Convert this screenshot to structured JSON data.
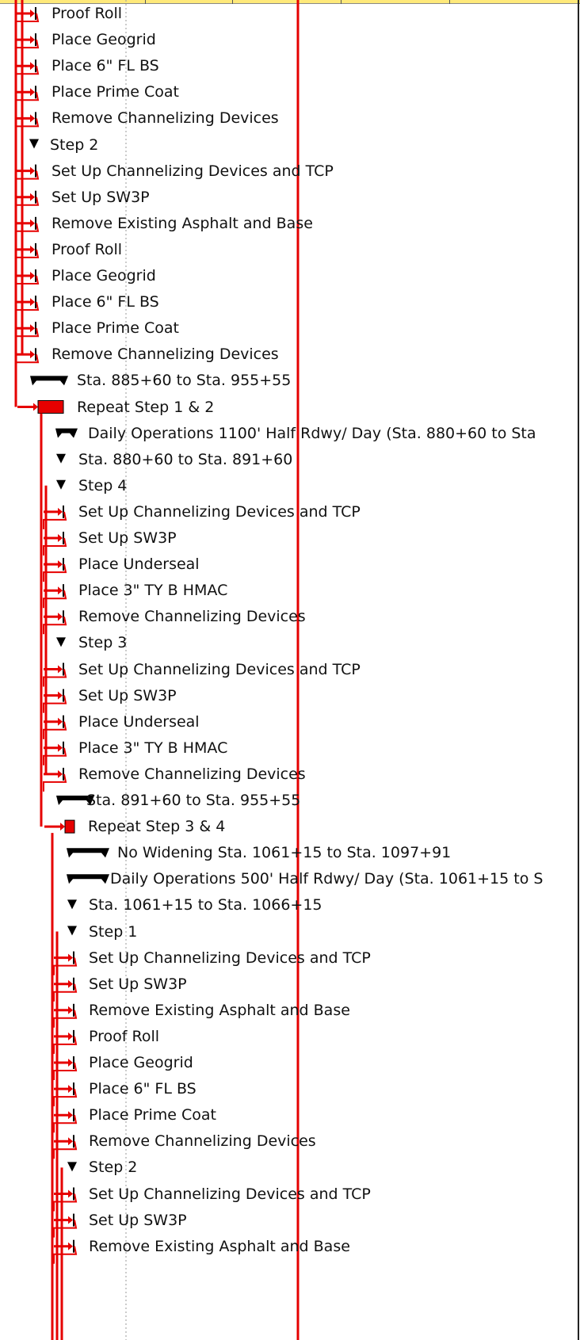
{
  "colors": {
    "link": "#e60000",
    "summary": "#000000",
    "task_bar": "#e60000",
    "grid_dotted": "#9a9a9a",
    "header_band": "#ffe97a"
  },
  "rows": [
    {
      "label": "Proof Roll",
      "kind": "task"
    },
    {
      "label": "Place Geogrid",
      "kind": "task"
    },
    {
      "label": "Place 6\" FL BS",
      "kind": "task"
    },
    {
      "label": "Place Prime Coat",
      "kind": "task"
    },
    {
      "label": "Remove Channelizing Devices",
      "kind": "task"
    },
    {
      "label": "Step 2",
      "kind": "group"
    },
    {
      "label": "Set Up Channelizing Devices and TCP",
      "kind": "task"
    },
    {
      "label": "Set Up SW3P",
      "kind": "task"
    },
    {
      "label": "Remove Existing Asphalt and Base",
      "kind": "task"
    },
    {
      "label": "Proof Roll",
      "kind": "task"
    },
    {
      "label": "Place Geogrid",
      "kind": "task"
    },
    {
      "label": "Place 6\" FL BS",
      "kind": "task"
    },
    {
      "label": "Place Prime Coat",
      "kind": "task"
    },
    {
      "label": "Remove Channelizing Devices",
      "kind": "task"
    },
    {
      "label": "Sta. 885+60 to Sta. 955+55",
      "kind": "summary"
    },
    {
      "label": "Repeat Step 1 & 2",
      "kind": "bar"
    },
    {
      "label": "Daily Operations 1100' Half Rdwy/ Day (Sta. 880+60 to Sta",
      "kind": "summary"
    },
    {
      "label": "Sta. 880+60 to Sta. 891+60",
      "kind": "group"
    },
    {
      "label": "Step 4",
      "kind": "group"
    },
    {
      "label": "Set Up Channelizing Devices and TCP",
      "kind": "task"
    },
    {
      "label": "Set Up SW3P",
      "kind": "task"
    },
    {
      "label": "Place Underseal",
      "kind": "task"
    },
    {
      "label": "Place 3\" TY B HMAC",
      "kind": "task"
    },
    {
      "label": "Remove Channelizing Devices",
      "kind": "task"
    },
    {
      "label": "Step 3",
      "kind": "group"
    },
    {
      "label": "Set Up Channelizing Devices and TCP",
      "kind": "task"
    },
    {
      "label": "Set Up SW3P",
      "kind": "task"
    },
    {
      "label": "Place Underseal",
      "kind": "task"
    },
    {
      "label": "Place 3\" TY B HMAC",
      "kind": "task"
    },
    {
      "label": "Remove Channelizing Devices",
      "kind": "task"
    },
    {
      "label": "Sta. 891+60 to Sta. 955+55",
      "kind": "summary"
    },
    {
      "label": "Repeat Step 3 & 4",
      "kind": "bar"
    },
    {
      "label": "No Widening Sta. 1061+15 to Sta. 1097+91",
      "kind": "summary"
    },
    {
      "label": "Daily Operations 500' Half Rdwy/ Day (Sta. 1061+15 to S",
      "kind": "summary"
    },
    {
      "label": "Sta. 1061+15 to Sta. 1066+15",
      "kind": "group"
    },
    {
      "label": "Step 1",
      "kind": "group"
    },
    {
      "label": "Set Up Channelizing Devices and TCP",
      "kind": "task"
    },
    {
      "label": "Set Up SW3P",
      "kind": "task"
    },
    {
      "label": "Remove Existing Asphalt and Base",
      "kind": "task"
    },
    {
      "label": "Proof Roll",
      "kind": "task"
    },
    {
      "label": "Place Geogrid",
      "kind": "task"
    },
    {
      "label": "Place 6\" FL BS",
      "kind": "task"
    },
    {
      "label": "Place Prime Coat",
      "kind": "task"
    },
    {
      "label": "Remove Channelizing Devices",
      "kind": "task"
    },
    {
      "label": "Step 2",
      "kind": "group"
    },
    {
      "label": "Set Up Channelizing Devices and TCP",
      "kind": "task"
    },
    {
      "label": "Set Up SW3P",
      "kind": "task"
    },
    {
      "label": "Remove Existing Asphalt and Base",
      "kind": "task"
    }
  ]
}
